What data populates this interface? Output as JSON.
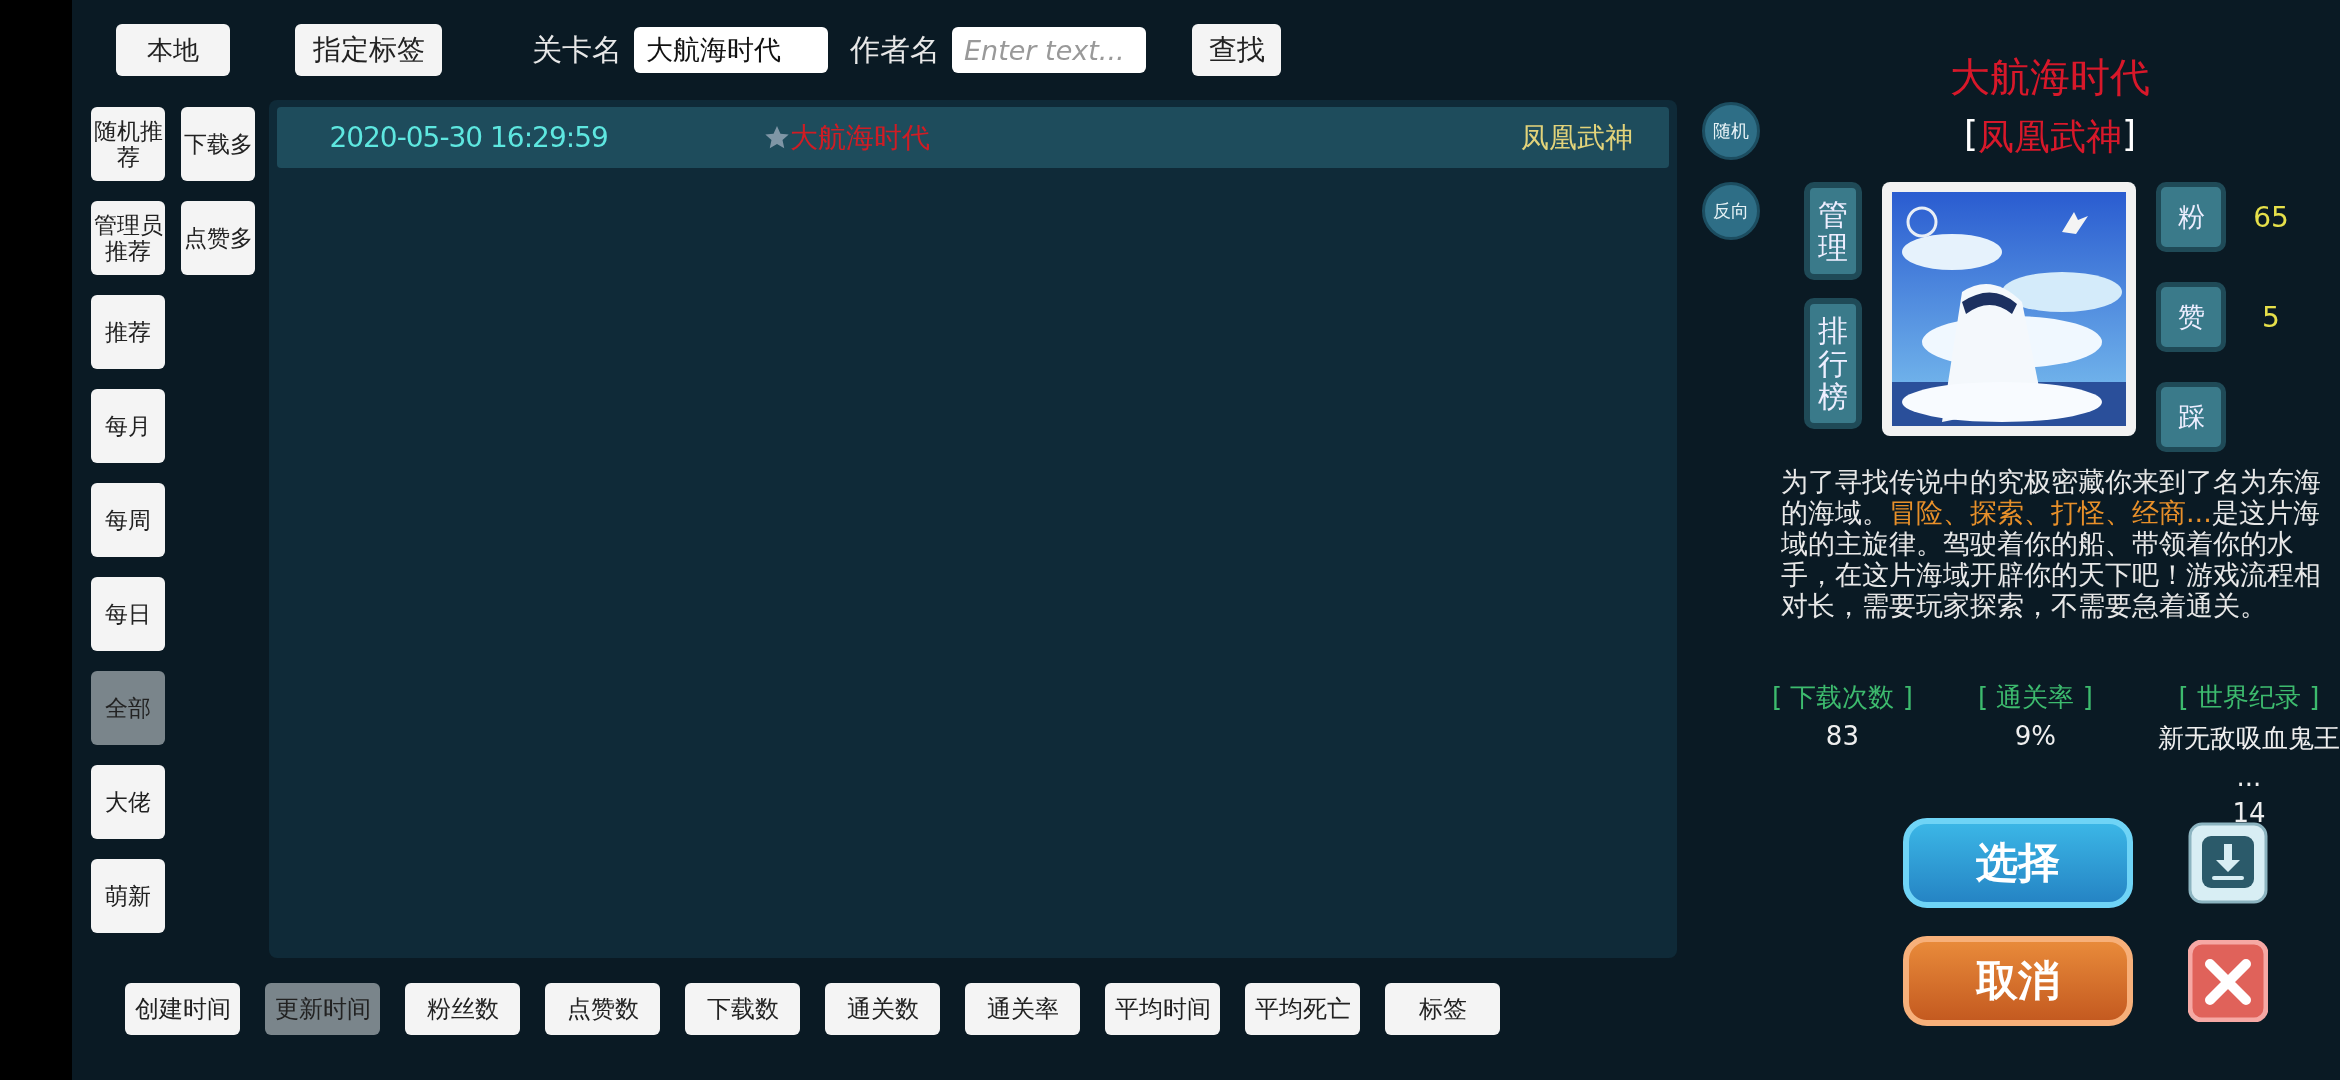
{
  "top_bar": {
    "local_button": "本地",
    "tag_button": "指定标签",
    "level_label": "关卡名",
    "level_value": "大航海时代",
    "author_label": "作者名",
    "author_placeholder": "Enter text...",
    "search_button": "查找"
  },
  "filter_rows": [
    {
      "items": [
        {
          "label": "随机推荐",
          "selected": false
        },
        {
          "label": "下载多",
          "selected": false
        }
      ]
    },
    {
      "items": [
        {
          "label": "管理员推荐",
          "selected": false
        },
        {
          "label": "点赞多",
          "selected": false
        }
      ]
    },
    {
      "items": [
        {
          "label": "推荐",
          "selected": false
        }
      ]
    },
    {
      "items": [
        {
          "label": "每月",
          "selected": false
        }
      ]
    },
    {
      "items": [
        {
          "label": "每周",
          "selected": false
        }
      ]
    },
    {
      "items": [
        {
          "label": "每日",
          "selected": false
        }
      ]
    },
    {
      "items": [
        {
          "label": "全部",
          "selected": true
        }
      ]
    },
    {
      "items": [
        {
          "label": "大佬",
          "selected": false
        }
      ]
    },
    {
      "items": [
        {
          "label": "萌新",
          "selected": false
        }
      ]
    }
  ],
  "levels": [
    {
      "date": "2020-05-30 16:29:59",
      "title": "大航海时代",
      "author": "凤凰武神"
    }
  ],
  "order_buttons": [
    "随机",
    "反向"
  ],
  "detail": {
    "title": "大航海时代",
    "author_open": "[",
    "author": "凤凰武神",
    "author_close": "]",
    "side_buttons": [
      "管理",
      "排行榜"
    ],
    "counters": [
      {
        "label": "粉",
        "value": "65"
      },
      {
        "label": "赞",
        "value": "5"
      },
      {
        "label": "踩"
      }
    ],
    "description": [
      {
        "text": "为了寻找传说中的究极密藏你来到了名为东海的海域。",
        "highlight": false
      },
      {
        "text": "冒险、探索、打怪、经商...",
        "highlight": true
      },
      {
        "text": "是这片海域的主旋律。驾驶着你的船、带领着你的水手，在这片海域开辟你的天下吧！游戏流程相对长，需要玩家探索，不需要急着通关。",
        "highlight": false
      }
    ],
    "stats": [
      {
        "label": "[ 下载次数 ]",
        "lines": [
          "83"
        ]
      },
      {
        "label": "[ 通关率 ]",
        "lines": [
          "9%"
        ]
      },
      {
        "label": "[ 世界纪录 ]",
        "lines": [
          "新无敌吸血鬼王",
          "...",
          "14"
        ]
      }
    ],
    "select_button": "选择",
    "cancel_button": "取消"
  },
  "sort_buttons": [
    {
      "label": "创建时间",
      "selected": false
    },
    {
      "label": "更新时间",
      "selected": true
    },
    {
      "label": "粉丝数",
      "selected": false
    },
    {
      "label": "点赞数",
      "selected": false
    },
    {
      "label": "下载数",
      "selected": false
    },
    {
      "label": "通关数",
      "selected": false
    },
    {
      "label": "通关率",
      "selected": false
    },
    {
      "label": "平均时间",
      "selected": false
    },
    {
      "label": "平均死亡",
      "selected": false
    },
    {
      "label": "标签",
      "selected": false
    }
  ]
}
